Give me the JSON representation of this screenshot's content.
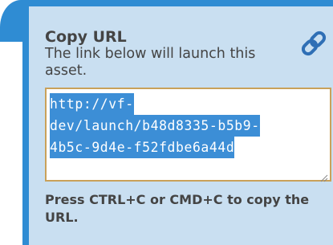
{
  "panel": {
    "title": "Copy URL",
    "description": "The link below will launch this asset.",
    "icon": "link-icon",
    "accent_color": "#2f8cd3",
    "background_color": "#c9dff1"
  },
  "url_field": {
    "lines": [
      "http://vf-",
      "dev/launch/b48d8335-b5b9-",
      "4b5c-9d4e-f52fdbe6a44d"
    ],
    "selected": true,
    "selection_color": "#3c8ed6",
    "border_color": "#c9a15a"
  },
  "instructions": {
    "text": "Press CTRL+C or CMD+C to copy the URL."
  }
}
